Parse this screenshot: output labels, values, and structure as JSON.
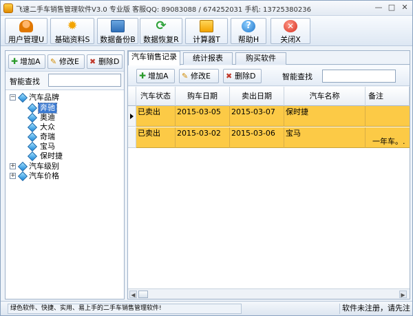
{
  "window": {
    "title": "飞速二手车销售管理软件V3.0 专业版  客服QQ: 89083088 / 674252031 手机: 13725380236",
    "minimize": "—",
    "maximize": "□",
    "close": "✕"
  },
  "toolbar": {
    "buttons": [
      {
        "label": "用户管理U",
        "icon": "user-icon"
      },
      {
        "label": "基础资料S",
        "icon": "gear-icon"
      },
      {
        "label": "数据备份B",
        "icon": "backup-icon"
      },
      {
        "label": "数据恢复R",
        "icon": "restore-icon"
      },
      {
        "label": "计算器T",
        "icon": "calculator-icon"
      },
      {
        "label": "帮助H",
        "icon": "help-icon"
      },
      {
        "label": "关闭X",
        "icon": "close-icon"
      }
    ]
  },
  "left": {
    "add": "增加A",
    "edit": "修改E",
    "delete": "删除D",
    "search_label": "智能查找",
    "search_value": "",
    "tree": {
      "brand": "汽车品牌",
      "brands": [
        "奔驰",
        "奥迪",
        "大众",
        "奇瑞",
        "宝马",
        "保时捷"
      ],
      "level": "汽车级别",
      "price": "汽车价格"
    }
  },
  "right": {
    "tabs": [
      "汽车销售记录",
      "统计报表",
      "购买软件"
    ],
    "add": "增加A",
    "edit": "修改E",
    "delete": "删除D",
    "search_label": "智能查找",
    "search_value": "",
    "columns": [
      "汽车状态",
      "购车日期",
      "卖出日期",
      "汽车名称",
      "备注"
    ],
    "rows": [
      {
        "status": "已卖出",
        "buy_date": "2015-03-05",
        "sell_date": "2015-03-07",
        "name": "保时捷",
        "note": ""
      },
      {
        "status": "已卖出",
        "buy_date": "2015-03-02",
        "sell_date": "2015-03-06",
        "name": "宝马",
        "note": "一年车。."
      }
    ]
  },
  "status": {
    "left": "绿色软件、快捷、实用、易上手的二手车销售管理软件!",
    "right": "软件未注册，请先注"
  },
  "colors": {
    "row_highlight": "#fcca46",
    "tree_selection": "#3a79d1"
  }
}
